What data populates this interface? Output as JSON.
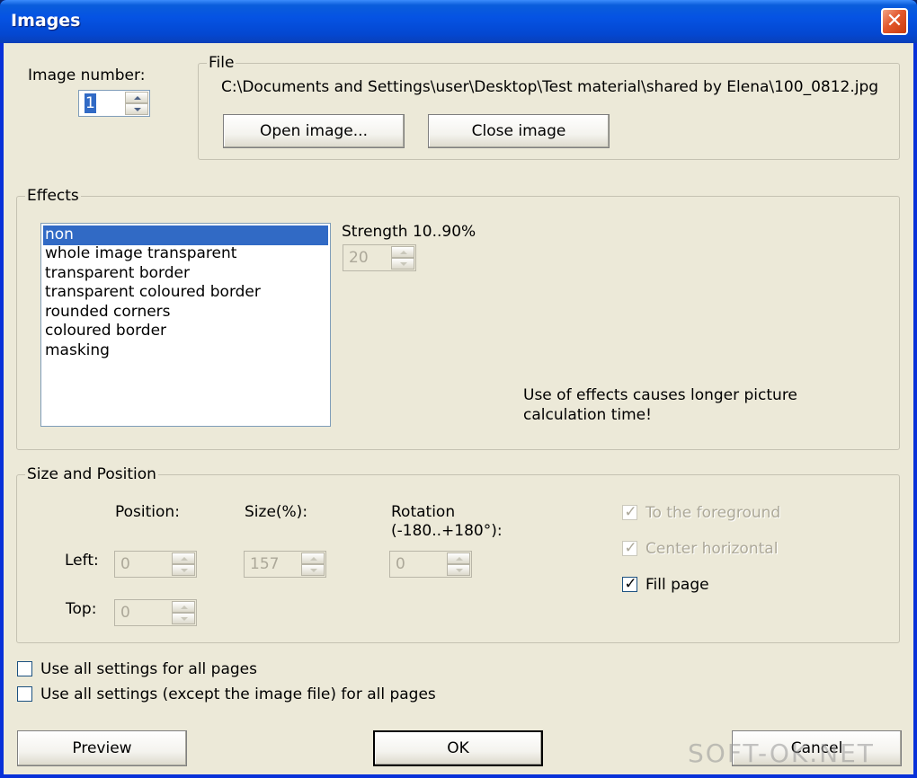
{
  "window": {
    "title": "Images",
    "close_symbol": "✕"
  },
  "image_number": {
    "label": "Image number:",
    "value": "1"
  },
  "file": {
    "group_label": "File",
    "path": "C:\\Documents and Settings\\user\\Desktop\\Test material\\shared by Elena\\100_0812.jpg",
    "open_button": "Open image...",
    "close_button": "Close image"
  },
  "effects": {
    "group_label": "Effects",
    "items": [
      {
        "label": "non",
        "selected": true
      },
      {
        "label": "whole image transparent",
        "selected": false
      },
      {
        "label": "transparent border",
        "selected": false
      },
      {
        "label": "transparent coloured border",
        "selected": false
      },
      {
        "label": "rounded corners",
        "selected": false
      },
      {
        "label": "coloured border",
        "selected": false
      },
      {
        "label": "masking",
        "selected": false
      }
    ],
    "strength_label": "Strength 10..90%",
    "strength_value": "20",
    "note_line1": "Use of effects causes longer picture",
    "note_line2": "calculation time!"
  },
  "size_position": {
    "group_label": "Size and Position",
    "position_header": "Position:",
    "size_header": "Size(%):",
    "rotation_header_line1": "Rotation",
    "rotation_header_line2": "(-180..+180°):",
    "left_label": "Left:",
    "top_label": "Top:",
    "left_value": "0",
    "top_value": "0",
    "size_value": "157",
    "rotation_value": "0",
    "to_foreground_label": "To the foreground",
    "center_horizontal_label": "Center horizontal",
    "fill_page_label": "Fill page",
    "check_symbol": "✓"
  },
  "global_options": {
    "all_settings_label": "Use all settings for all pages",
    "all_settings_except_label": "Use all settings (except the image file) for all pages"
  },
  "buttons": {
    "preview": "Preview",
    "ok": "OK",
    "cancel": "Cancel"
  },
  "watermark": "SOFT-OK.NET"
}
